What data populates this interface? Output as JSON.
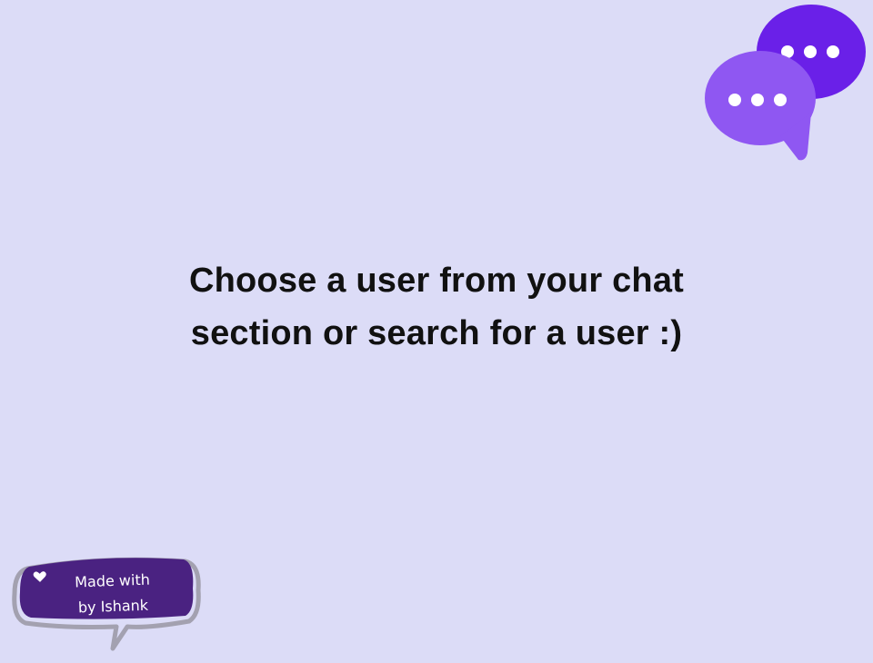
{
  "empty_state": {
    "line1": "Choose a user from your chat",
    "line2": "section or search for a user :)"
  },
  "credit": {
    "line1": "Made with",
    "line2": "by Ishank",
    "icon": "heart-icon"
  },
  "illustration": {
    "icon": "chat-bubbles-icon"
  },
  "colors": {
    "background": "#dcdcf7",
    "bubble_back": "#6a20e8",
    "bubble_front": "#8f57f2",
    "badge_fill": "#4a2281",
    "badge_outline": "#a3a1b0",
    "text": "#111111"
  }
}
